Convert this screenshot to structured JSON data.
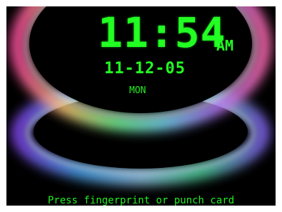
{
  "clock": {
    "time": "11:54",
    "ampm": "AM",
    "date": "11-12-05",
    "weekday": "MON"
  },
  "prompt": {
    "text": "Press fingerprint or punch card"
  },
  "colors": {
    "display_green": "#22ff22",
    "background": "#000000"
  }
}
